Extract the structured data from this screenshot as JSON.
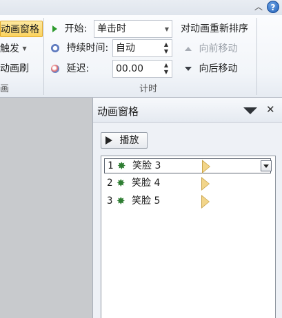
{
  "ribbon": {
    "group_left": {
      "animation_pane_button": "动画窗格",
      "trigger_button": "触发",
      "animation_painter_button": "动画刷",
      "group_label": "画"
    },
    "timing": {
      "start_label": "开始:",
      "start_value": "单击时",
      "duration_label": "持续时间:",
      "duration_value": "自动",
      "delay_label": "延迟:",
      "delay_value": "00.00",
      "group_label": "计时"
    },
    "reorder": {
      "title": "对动画重新排序",
      "move_earlier": "向前移动",
      "move_later": "向后移动"
    }
  },
  "pane": {
    "title": "动画窗格",
    "play_button": "播放",
    "items": [
      {
        "num": "1",
        "name": "笑脸 3",
        "selected": true
      },
      {
        "num": "2",
        "name": "笑脸 4",
        "selected": false
      },
      {
        "num": "3",
        "name": "笑脸 5",
        "selected": false
      }
    ]
  },
  "icons": {
    "help": "?",
    "close": "✕",
    "chevron_up": "︿"
  },
  "colors": {
    "highlight": "#fbd35e",
    "effect_star": "#2e7d32",
    "timeline_bar": "#f2d58a"
  }
}
